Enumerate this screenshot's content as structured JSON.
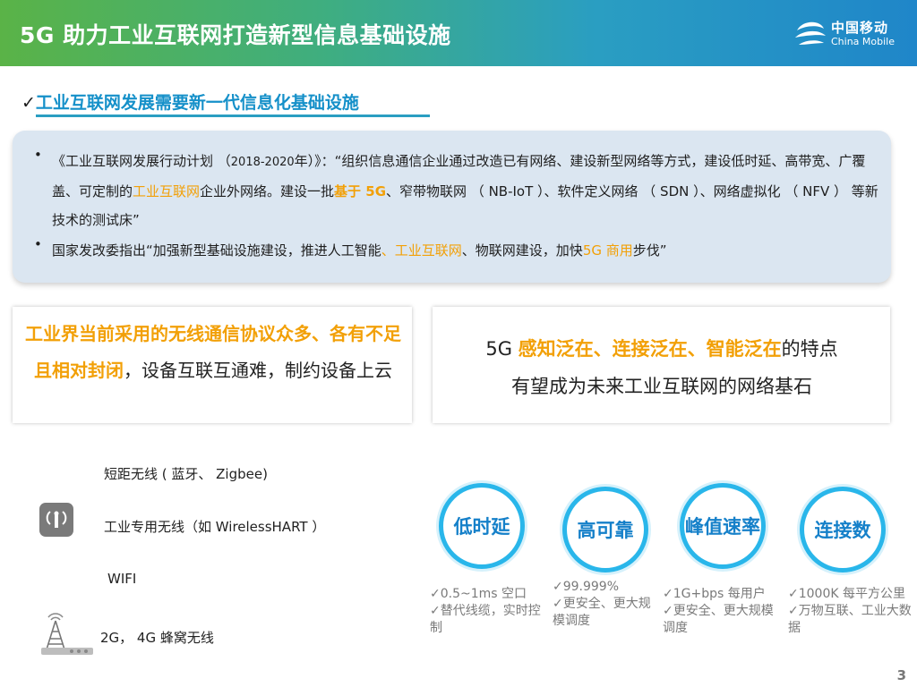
{
  "header": {
    "title": "5G 助力工业互联网打造新型信息基础设施",
    "logo_cn": "中国移动",
    "logo_en": "China Mobile"
  },
  "section": {
    "check": "✓",
    "heading": "工业互联网发展需要新一代信息化基础设施"
  },
  "info": {
    "bullet_char": "•",
    "b1_p1": "《工业互联网发展行动计划 （",
    "b1_year": "2018-2020",
    "b1_p2": "年）》：“组织信息通信企业通过改造已有网络、建设新型网络等方式，建设低时延、高带宽、广覆盖、可定制的",
    "b1_hl1": "工业互联网",
    "b1_p3": "企业外网络。建设一批",
    "b1_hl2": "基于 5G",
    "b1_p4": "、窄带物联网 （ NB-IoT ）、软件定义网络 （ SDN ）、网络虚拟化 （ NFV ） 等新技术的测试床”",
    "b2_p1": "国家发改委指出“加强新型基础设施建设，推进人工智能",
    "b2_hl1": "、工业互联网",
    "b2_p2": "、物联网建设，加快",
    "b2_hl2": "5G 商用",
    "b2_p3": "步伐”"
  },
  "box_left": {
    "orange": "工业界当前采用的无线通信协议众多、各有不足且相对封闭",
    "rest": "，设备互联互通难，制约设备上云"
  },
  "box_right": {
    "prefix": "5G ",
    "orange": "感知泛在、连接泛在、智能泛在",
    "line1_end": "的特点",
    "line2": "有望成为未来工业互联网的网络基石"
  },
  "wireless": [
    {
      "label": "短距无线 ( 蓝牙、 Zigbee)"
    },
    {
      "label": "工业专用无线（如 WirelessHART ）"
    },
    {
      "label": "WIFI"
    },
    {
      "label": "2G， 4G 蜂窝无线"
    }
  ],
  "features": [
    {
      "label": "低时延",
      "desc": [
        "✓0.5~1ms 空口",
        "✓替代线缆，实时控制"
      ]
    },
    {
      "label": "高可靠",
      "desc": [
        "✓99.999%",
        "✓更安全、更大规模调度"
      ]
    },
    {
      "label": "峰值速率",
      "desc": [
        "✓1G+bps 每用户",
        "✓更安全、更大规模调度"
      ]
    },
    {
      "label": "连接数",
      "desc": [
        "✓1000K 每平方公里",
        "✓万物互联、工业大数据"
      ]
    }
  ],
  "page_number": "3",
  "colors": {
    "accent_blue": "#1590c9",
    "highlight_orange": "#f2a007",
    "circle_border": "#29b6ea"
  }
}
